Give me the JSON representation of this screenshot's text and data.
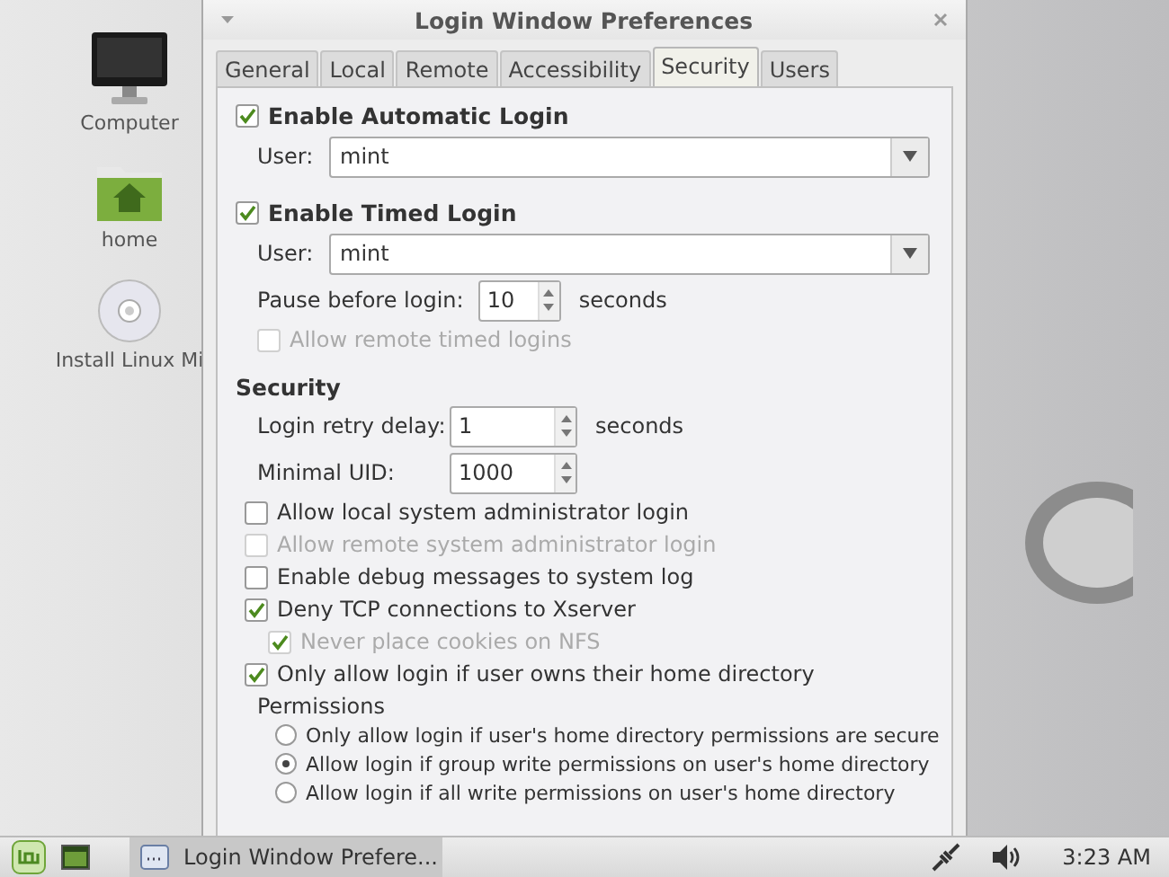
{
  "desktop_icons": [
    {
      "kind": "computer",
      "label": "Computer"
    },
    {
      "kind": "home",
      "label": "home"
    },
    {
      "kind": "disc",
      "label": "Install Linux Mi"
    }
  ],
  "window": {
    "title": "Login Window Preferences"
  },
  "tabs": [
    {
      "label": "General",
      "selected": false
    },
    {
      "label": "Local",
      "selected": false
    },
    {
      "label": "Remote",
      "selected": false
    },
    {
      "label": "Accessibility",
      "selected": false
    },
    {
      "label": "Security",
      "selected": true
    },
    {
      "label": "Users",
      "selected": false
    }
  ],
  "automatic_login": {
    "label": "Enable Automatic Login",
    "checked": true,
    "user_label": "User:",
    "user": "mint"
  },
  "timed_login": {
    "label": "Enable Timed Login",
    "checked": true,
    "user_label": "User:",
    "user": "mint",
    "pause_label": "Pause before login:",
    "pause": "10",
    "pause_unit": "seconds",
    "remote": {
      "label": "Allow remote timed logins",
      "checked": false,
      "disabled": true
    }
  },
  "security": {
    "heading": "Security",
    "retry_label": "Login retry delay:",
    "retry": "1",
    "retry_unit": "seconds",
    "uid_label": "Minimal UID:",
    "uid": "1000",
    "options": [
      {
        "label": "Allow local system administrator login",
        "checked": false,
        "disabled": false
      },
      {
        "label": "Allow remote system administrator login",
        "checked": false,
        "disabled": true
      },
      {
        "label": "Enable debug messages to system log",
        "checked": false,
        "disabled": false
      },
      {
        "label": "Deny TCP connections to Xserver",
        "checked": true,
        "disabled": false,
        "children": [
          {
            "label": "Never place cookies on NFS",
            "checked": true,
            "disabled": true
          }
        ]
      },
      {
        "label": "Only allow login if user owns their home directory",
        "checked": true,
        "disabled": false
      }
    ]
  },
  "permissions": {
    "heading": "Permissions",
    "options": [
      {
        "label": "Only allow login if user's home directory permissions are secure",
        "selected": false
      },
      {
        "label": "Allow login if group write permissions on user's home directory",
        "selected": true
      },
      {
        "label": "Allow login if all write permissions on user's home directory",
        "selected": false
      }
    ]
  },
  "taskbar": {
    "window_button": "Login Window Prefere...",
    "clock": "3:23 AM"
  }
}
